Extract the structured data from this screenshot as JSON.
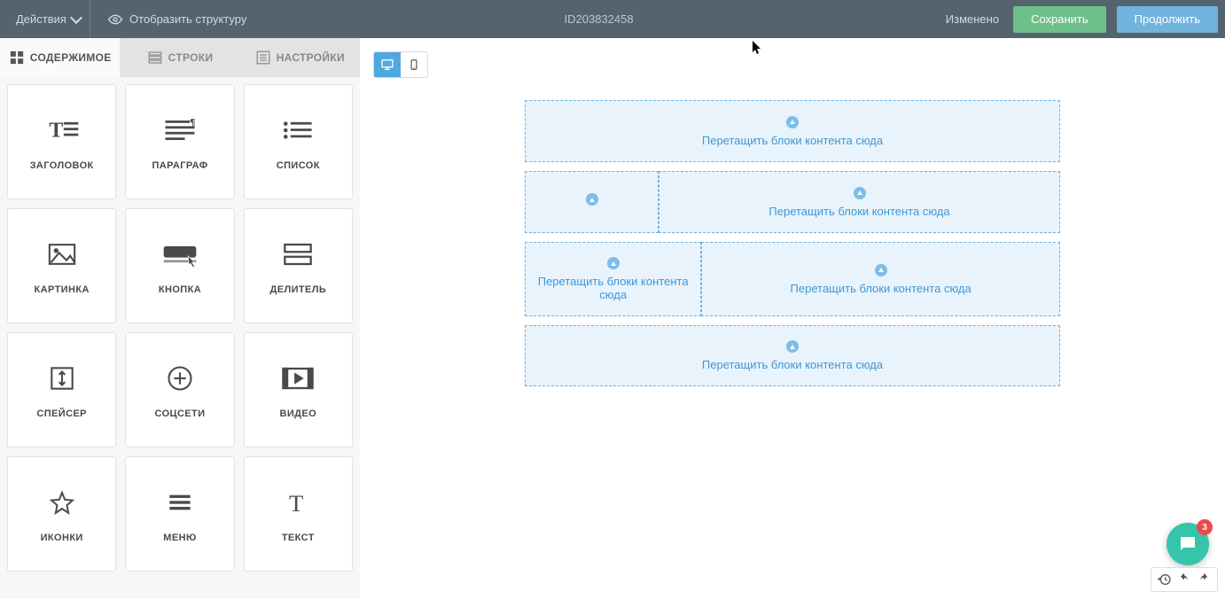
{
  "topbar": {
    "actions_label": "Действия",
    "show_structure": "Отобразить структуру",
    "doc_id": "ID203832458",
    "status": "Изменено",
    "save": "Сохранить",
    "continue": "Продолжить"
  },
  "tabs": {
    "content": "СОДЕРЖИМОЕ",
    "rows": "СТРОКИ",
    "settings": "НАСТРОЙКИ"
  },
  "blocks": {
    "heading": "ЗАГОЛОВОК",
    "paragraph": "ПАРАГРАФ",
    "list": "СПИСОК",
    "image": "КАРТИНКА",
    "button": "КНОПКА",
    "divider": "ДЕЛИТЕЛЬ",
    "spacer": "СПЕЙСЕР",
    "social": "СОЦСЕТИ",
    "video": "ВИДЕО",
    "icons": "ИКОНКИ",
    "menu": "МЕНЮ",
    "text": "ТЕКСТ"
  },
  "dropzone": {
    "full_hint": "Перетащить блоки контента сюда",
    "short_hint": "Перетащить блоки контента сюда"
  },
  "chat": {
    "badge": "3"
  }
}
